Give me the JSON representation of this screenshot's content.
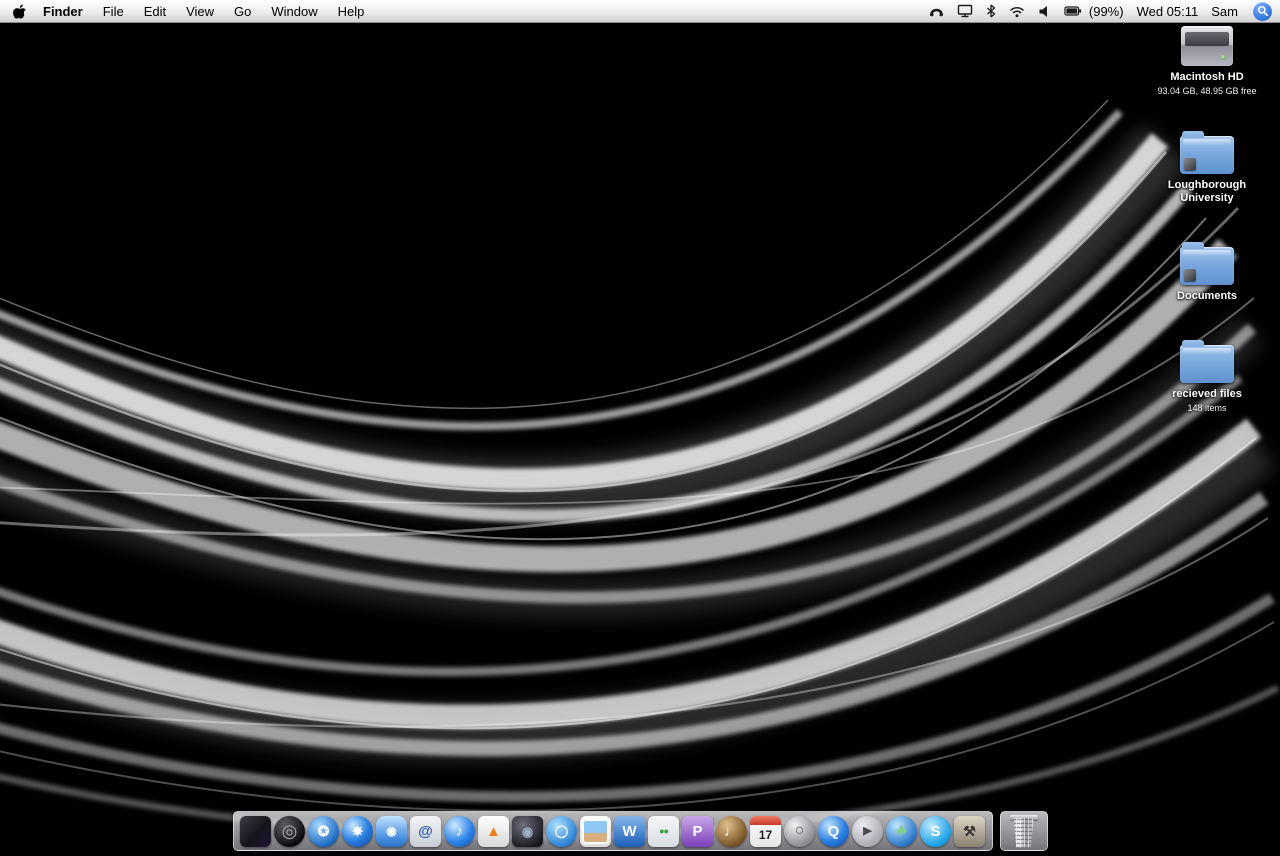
{
  "menubar": {
    "app": "Finder",
    "menus": [
      "File",
      "Edit",
      "View",
      "Go",
      "Window",
      "Help"
    ],
    "status": {
      "battery": "(99%)",
      "clock": "Wed 05:11",
      "user": "Sam"
    }
  },
  "desktop_icons": [
    {
      "label": "Macintosh HD",
      "sublabel": "93.04 GB, 48.95 GB free",
      "type": "hard-drive"
    },
    {
      "label": "Loughborough University",
      "sublabel": "",
      "type": "folder"
    },
    {
      "label": "Documents",
      "sublabel": "",
      "type": "folder"
    },
    {
      "label": "recieved files",
      "sublabel": "148 items",
      "type": "folder"
    }
  ],
  "dock": {
    "items": [
      {
        "label": "Finder",
        "glyph": ""
      },
      {
        "label": "Aperture",
        "glyph": "◎"
      },
      {
        "label": "Azureus",
        "glyph": "✪"
      },
      {
        "label": "Safari",
        "glyph": "✵"
      },
      {
        "label": "iChat",
        "glyph": "◉"
      },
      {
        "label": "Mail",
        "glyph": "@"
      },
      {
        "label": "iTunes",
        "glyph": "♪"
      },
      {
        "label": "VLC",
        "glyph": "▲"
      },
      {
        "label": "iDVD",
        "glyph": "◉"
      },
      {
        "label": "iWeb",
        "glyph": "◯"
      },
      {
        "label": "iPhoto",
        "glyph": ""
      },
      {
        "label": "Microsoft Word",
        "glyph": "W"
      },
      {
        "label": "Messenger",
        "glyph": "●●"
      },
      {
        "label": "Microsoft PowerPoint",
        "glyph": "P"
      },
      {
        "label": "GarageBand",
        "glyph": "♩"
      },
      {
        "label": "iCal",
        "glyph": "17"
      },
      {
        "label": "DVD Player",
        "glyph": "○"
      },
      {
        "label": "QuickTime Player",
        "glyph": "Q"
      },
      {
        "label": "Front Row",
        "glyph": "▶"
      },
      {
        "label": "Google Earth",
        "glyph": "☘"
      },
      {
        "label": "Skype",
        "glyph": "S"
      },
      {
        "label": "Toolbox",
        "glyph": "⚒"
      }
    ],
    "trash": {
      "label": "Trash"
    }
  },
  "colors": {
    "spotlight_blue": "#2a71d9",
    "folder_blue": "#6d9ed8",
    "menubar_bg": "#ececec",
    "dock_bg": "#c8c8cd"
  }
}
